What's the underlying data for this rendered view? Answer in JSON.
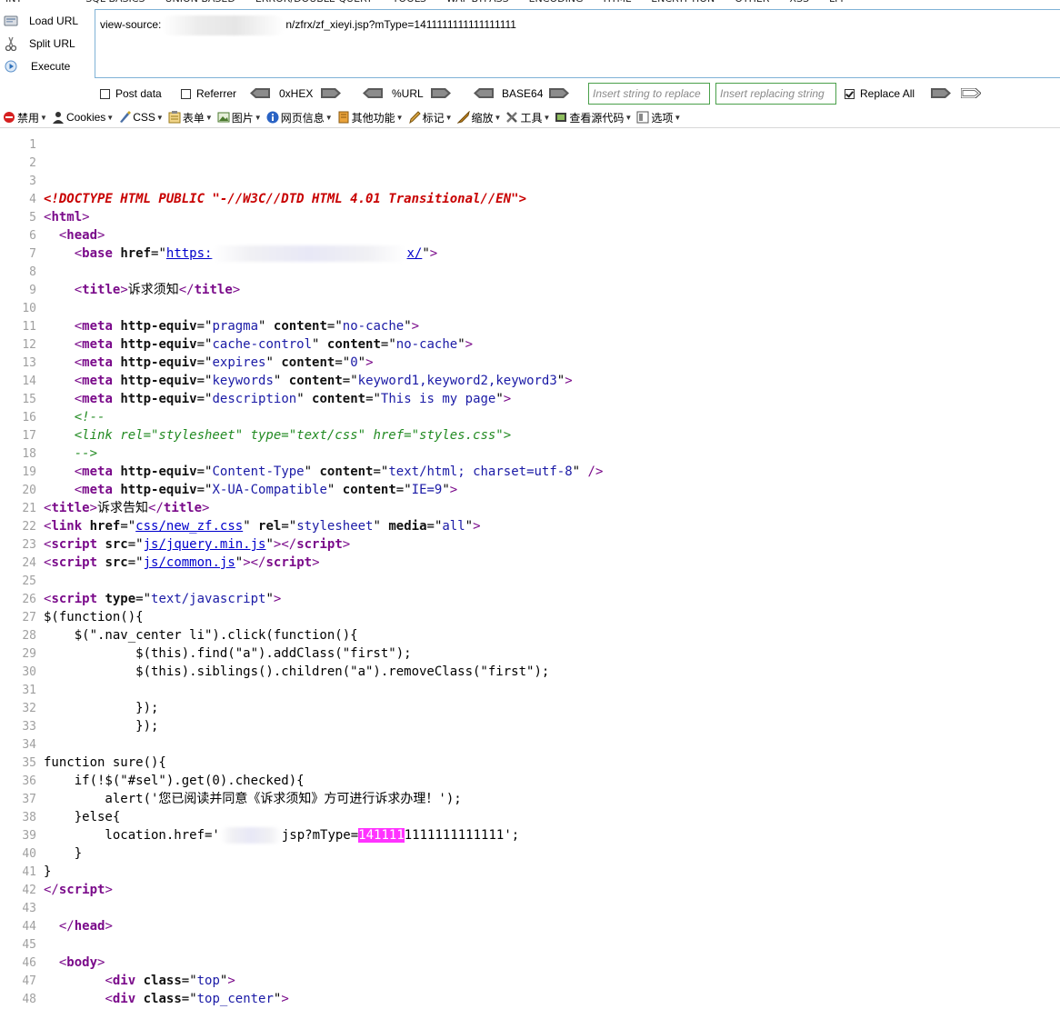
{
  "top_menu": [
    "INT",
    "SQL BASICS",
    "UNION BASED",
    "ERROR/DOUBLE QUERY",
    "TOOLS",
    "WAF BYPASS",
    "ENCODING",
    "HTML",
    "ENCRYPTION",
    "OTHER",
    "XSS",
    "LFI"
  ],
  "hackbar": {
    "load_url": "Load URL",
    "split_url": "Split URL",
    "execute": "Execute",
    "url_prefix": "view-source:",
    "url_suffix": "n/zfrx/zf_xieyi.jsp?mType=1411111111111111111",
    "post_data": "Post data",
    "referrer": "Referrer",
    "hex": "0xHEX",
    "url_enc": "%URL",
    "base64": "BASE64",
    "insert_placeholder": "Insert string to replace",
    "replacing_placeholder": "Insert replacing string",
    "replace_all": "Replace All",
    "replace_all_checked": true
  },
  "toolbar": [
    {
      "label": "禁用",
      "icon": "disable-icon"
    },
    {
      "label": "Cookies",
      "icon": "cookies-icon"
    },
    {
      "label": "CSS",
      "icon": "css-icon"
    },
    {
      "label": "表单",
      "icon": "forms-icon"
    },
    {
      "label": "图片",
      "icon": "images-icon"
    },
    {
      "label": "网页信息",
      "icon": "info-icon"
    },
    {
      "label": "其他功能",
      "icon": "misc-icon"
    },
    {
      "label": "标记",
      "icon": "outline-icon"
    },
    {
      "label": "缩放",
      "icon": "resize-icon"
    },
    {
      "label": "工具",
      "icon": "tools-icon"
    },
    {
      "label": "查看源代码",
      "icon": "view-source-icon"
    },
    {
      "label": "选项",
      "icon": "options-icon"
    }
  ],
  "source": {
    "doctype": "<!DOCTYPE HTML PUBLIC \"-//W3C//DTD HTML 4.01 Transitional//EN\">",
    "base_href_start": "https:",
    "base_href_end": "x/",
    "title1": "诉求须知",
    "meta_pragma": [
      "pragma",
      "no-cache"
    ],
    "meta_cache": [
      "cache-control",
      "no-cache"
    ],
    "meta_expires": [
      "expires",
      "0"
    ],
    "meta_keywords": [
      "keywords",
      "keyword1,keyword2,keyword3"
    ],
    "meta_description": [
      "description",
      "This is my page"
    ],
    "comment_open": "<!--",
    "comment_link": "<link rel=\"stylesheet\" type=\"text/css\" href=\"styles.css\">",
    "comment_close": "-->",
    "meta_content_type": [
      "Content-Type",
      "text/html; charset=utf-8"
    ],
    "meta_ua": [
      "X-UA-Compatible",
      "IE=9"
    ],
    "title2": "诉求告知",
    "link_href": "css/new_zf.css",
    "link_rel": "stylesheet",
    "link_media": "all",
    "script1": "js/jquery.min.js",
    "script2": "js/common.js",
    "script_type": "text/javascript",
    "js": {
      "l27": "$(function(){",
      "l28": "    $(\".nav_center li\").click(function(){",
      "l29": "            $(this).find(\"a\").addClass(\"first\");",
      "l30": "            $(this).siblings().children(\"a\").removeClass(\"first\");",
      "l32": "            });",
      "l33": "            });",
      "l35": "function sure(){",
      "l36": "    if(!$(\"#sel\").get(0).checked){",
      "l37": "        alert('您已阅读并同意《诉求须知》方可进行诉求办理！');",
      "l38": "    }else{",
      "l39_a": "        location.href='",
      "l39_b": "jsp?mType=",
      "l39_hl": "141111",
      "l39_c": "1111111111111';",
      "l40": "    }",
      "l41": "}"
    },
    "div_top": "top",
    "div_top_center": "top_center"
  }
}
